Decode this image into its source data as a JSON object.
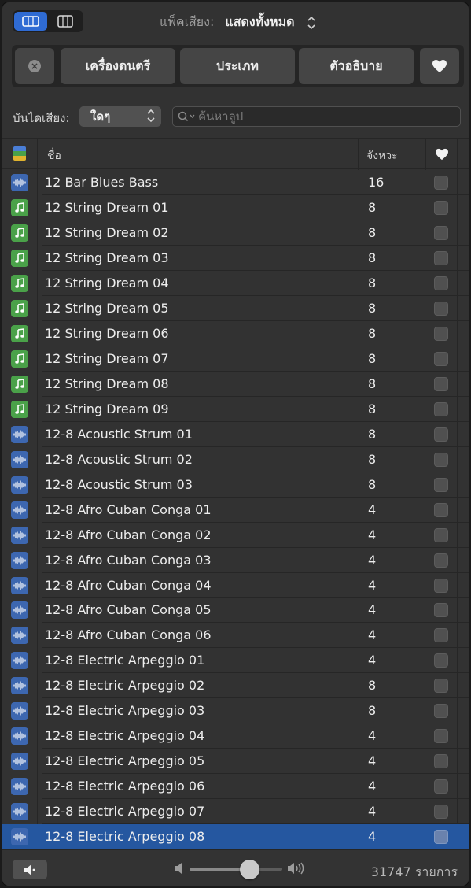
{
  "toolbar": {
    "view_modes": [
      "list-view-icon",
      "column-view-icon"
    ],
    "sound_pack_label": "แพ็คเสียง:",
    "sound_pack_value": "แสดงทั้งหมด"
  },
  "filters": {
    "instrument": "เครื่องดนตรี",
    "genre": "ประเภท",
    "descriptor": "ตัวอธิบาย"
  },
  "scale": {
    "label": "บันไดเสียง:",
    "value": "ใดๆ"
  },
  "search": {
    "placeholder": "ค้นหาลูป"
  },
  "table": {
    "columns": {
      "name": "ชื่อ",
      "beats": "จังหวะ"
    },
    "rows": [
      {
        "type": "audio",
        "name": "12 Bar Blues Bass",
        "beats": "16"
      },
      {
        "type": "midi",
        "name": "12 String Dream 01",
        "beats": "8"
      },
      {
        "type": "midi",
        "name": "12 String Dream 02",
        "beats": "8"
      },
      {
        "type": "midi",
        "name": "12 String Dream 03",
        "beats": "8"
      },
      {
        "type": "midi",
        "name": "12 String Dream 04",
        "beats": "8"
      },
      {
        "type": "midi",
        "name": "12 String Dream 05",
        "beats": "8"
      },
      {
        "type": "midi",
        "name": "12 String Dream 06",
        "beats": "8"
      },
      {
        "type": "midi",
        "name": "12 String Dream 07",
        "beats": "8"
      },
      {
        "type": "midi",
        "name": "12 String Dream 08",
        "beats": "8"
      },
      {
        "type": "midi",
        "name": "12 String Dream 09",
        "beats": "8"
      },
      {
        "type": "audio",
        "name": "12-8 Acoustic Strum 01",
        "beats": "8"
      },
      {
        "type": "audio",
        "name": "12-8 Acoustic Strum 02",
        "beats": "8"
      },
      {
        "type": "audio",
        "name": "12-8 Acoustic Strum 03",
        "beats": "8"
      },
      {
        "type": "audio",
        "name": "12-8 Afro Cuban Conga 01",
        "beats": "4"
      },
      {
        "type": "audio",
        "name": "12-8 Afro Cuban Conga 02",
        "beats": "4"
      },
      {
        "type": "audio",
        "name": "12-8 Afro Cuban Conga 03",
        "beats": "4"
      },
      {
        "type": "audio",
        "name": "12-8 Afro Cuban Conga 04",
        "beats": "4"
      },
      {
        "type": "audio",
        "name": "12-8 Afro Cuban Conga 05",
        "beats": "4"
      },
      {
        "type": "audio",
        "name": "12-8 Afro Cuban Conga 06",
        "beats": "4"
      },
      {
        "type": "audio",
        "name": "12-8 Electric Arpeggio 01",
        "beats": "4"
      },
      {
        "type": "audio",
        "name": "12-8 Electric Arpeggio 02",
        "beats": "8"
      },
      {
        "type": "audio",
        "name": "12-8 Electric Arpeggio 03",
        "beats": "8"
      },
      {
        "type": "audio",
        "name": "12-8 Electric Arpeggio 04",
        "beats": "4"
      },
      {
        "type": "audio",
        "name": "12-8 Electric Arpeggio 05",
        "beats": "4"
      },
      {
        "type": "audio",
        "name": "12-8 Electric Arpeggio 06",
        "beats": "4"
      },
      {
        "type": "audio",
        "name": "12-8 Electric Arpeggio 07",
        "beats": "4"
      },
      {
        "type": "audio",
        "name": "12-8 Electric Arpeggio 08",
        "beats": "4",
        "selected": true
      }
    ]
  },
  "footer": {
    "volume_level": 0.65,
    "count_text": "31747 รายการ"
  },
  "colors": {
    "accent": "#2f6bd3",
    "selection": "#2557a0",
    "audio_icon": "#3d67b0",
    "midi_icon": "#4aa149"
  }
}
